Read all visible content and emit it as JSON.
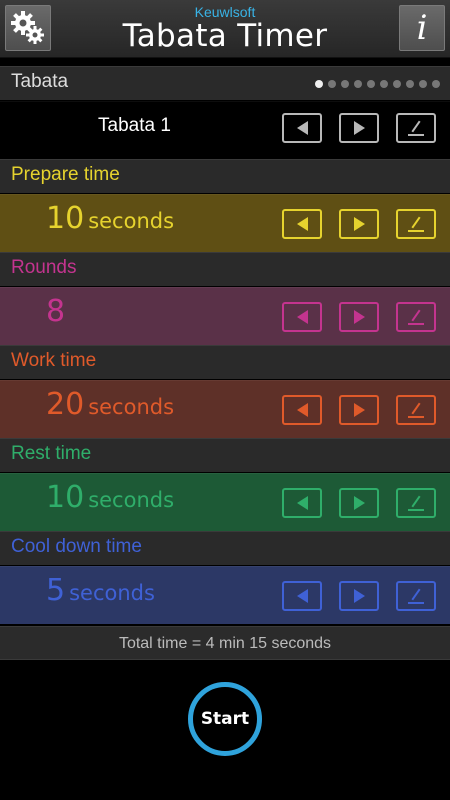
{
  "header": {
    "brand": "Keuwlsoft",
    "title": "Tabata Timer",
    "settings_icon": "gears-icon",
    "info_icon": "info-icon",
    "info_glyph": "i"
  },
  "preset": {
    "section_label": "Tabata",
    "page_dots": {
      "count": 10,
      "active_index": 0
    },
    "name": "Tabata 1"
  },
  "sections": [
    {
      "label": "Prepare time",
      "value": "10",
      "unit": "seconds",
      "color": "#e6d32e",
      "row_bg": "#5f4f14",
      "header_bg": "#2a2a2a"
    },
    {
      "label": "Rounds",
      "value": "8",
      "unit": "",
      "color": "#c4348f",
      "row_bg": "#5a3148",
      "header_bg": "#2a2a2a"
    },
    {
      "label": "Work time",
      "value": "20",
      "unit": "seconds",
      "color": "#e05a2a",
      "row_bg": "#5e3028",
      "header_bg": "#2a2a2a"
    },
    {
      "label": "Rest time",
      "value": "10",
      "unit": "seconds",
      "color": "#2fae6a",
      "row_bg": "#1d5a36",
      "header_bg": "#2a2a2a"
    },
    {
      "label": "Cool down time",
      "value": "5",
      "unit": "seconds",
      "color": "#3f61d6",
      "row_bg": "#2c3866",
      "header_bg": "#2a2a2a"
    }
  ],
  "total": "Total time = 4 min 15 seconds",
  "start_label": "Start",
  "colors": {
    "accent": "#2fa3dc",
    "brand": "#39b3e6",
    "preset_controls": "#b8b8b8"
  }
}
